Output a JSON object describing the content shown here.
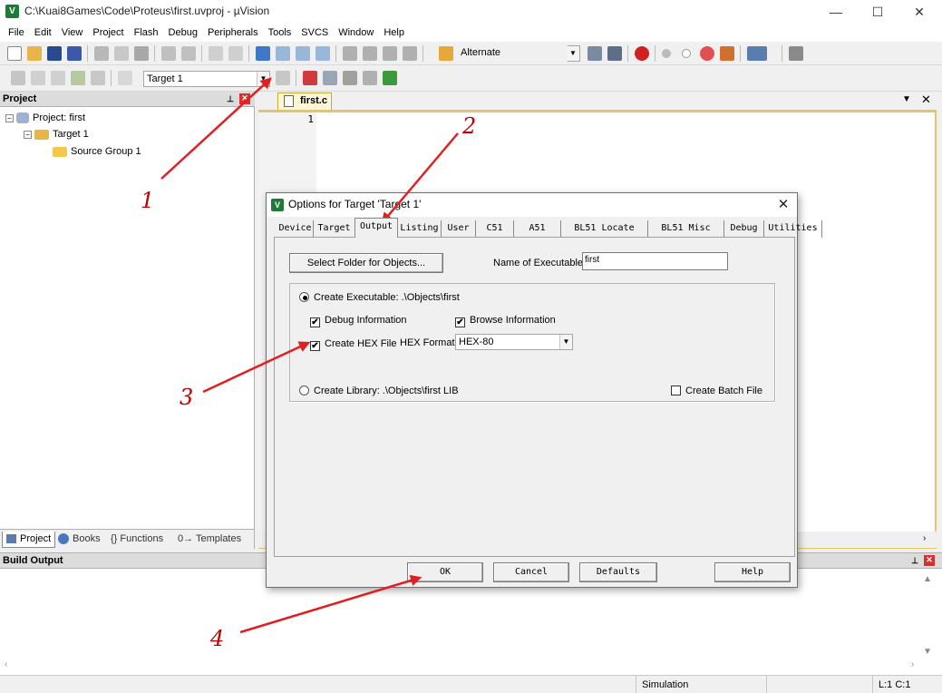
{
  "window": {
    "title": "C:\\Kuai8Games\\Code\\Proteus\\first.uvproj - µVision",
    "minimize": "—",
    "maximize": "☐",
    "close": "✕"
  },
  "menu": [
    "File",
    "Edit",
    "View",
    "Project",
    "Flash",
    "Debug",
    "Peripherals",
    "Tools",
    "SVCS",
    "Window",
    "Help"
  ],
  "toolbar1": {
    "combo_value": "Alternate"
  },
  "toolbar2": {
    "target_value": "Target 1"
  },
  "project_panel": {
    "title": "Project",
    "tree": {
      "project": "Project: first",
      "target": "Target 1",
      "group": "Source Group 1"
    },
    "tabs": [
      "Project",
      "Books",
      "{} Functions",
      "0→ Templates"
    ]
  },
  "editor": {
    "tab_label": "first.c",
    "line_number": "1"
  },
  "build_output": {
    "title": "Build Output"
  },
  "statusbar": {
    "mode": "Simulation",
    "position": "L:1 C:1"
  },
  "dialog": {
    "title": "Options for Target 'Target 1'",
    "tabs": [
      "Device",
      "Target",
      "Output",
      "Listing",
      "User",
      "C51",
      "A51",
      "BL51 Locate",
      "BL51 Misc",
      "Debug",
      "Utilities"
    ],
    "active_tab": "Output",
    "select_folder_label": "Select Folder for Objects...",
    "name_of_executable_label": "Name of Executable:",
    "name_of_executable_value": "first",
    "create_executable_label": "Create Executable:  .\\Objects\\first",
    "debug_information_label": "Debug Information",
    "browse_information_label": "Browse Information",
    "create_hex_label": "Create HEX File",
    "hex_format_label": "HEX Format:",
    "hex_format_value": "HEX-80",
    "create_library_label": "Create Library:  .\\Objects\\first LIB",
    "create_batch_label": "Create Batch File",
    "ok_label": "OK",
    "cancel_label": "Cancel",
    "defaults_label": "Defaults",
    "help_label": "Help",
    "check_mark": "✔"
  },
  "annotations": [
    "1",
    "2",
    "3",
    "4"
  ],
  "colors": {
    "annotation_red": "#e02020",
    "editor_border": "#e3c66a",
    "keil_green": "#1f7a3a"
  }
}
